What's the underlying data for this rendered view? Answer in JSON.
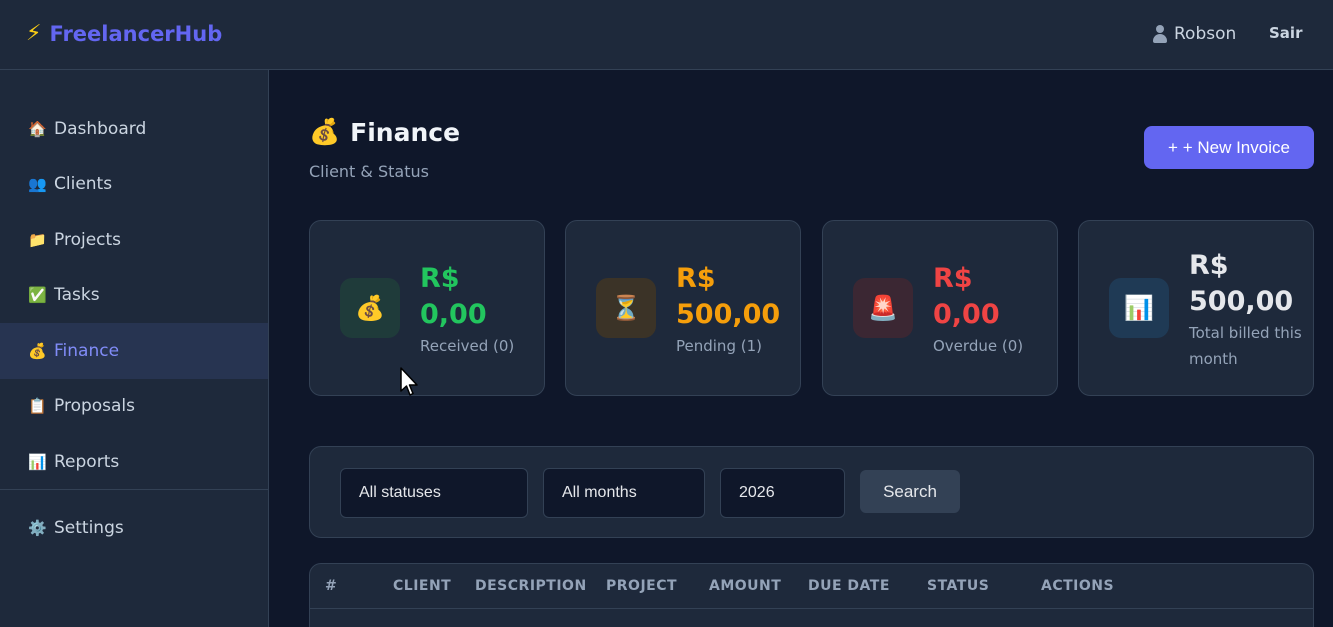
{
  "app": {
    "brand": "FreelancerHub",
    "brand_icon": "lightning-icon",
    "user_name": "Robson",
    "logout": "Sair"
  },
  "sidebar": {
    "items": [
      {
        "label": "Dashboard",
        "icon": "🏠",
        "active": false
      },
      {
        "label": "Clients",
        "icon": "👥",
        "active": false
      },
      {
        "label": "Projects",
        "icon": "📁",
        "active": false
      },
      {
        "label": "Tasks",
        "icon": "✅",
        "active": false
      },
      {
        "label": "Finance",
        "icon": "💰",
        "active": true
      },
      {
        "label": "Proposals",
        "icon": "📋",
        "active": false
      },
      {
        "label": "Reports",
        "icon": "📊",
        "active": false
      },
      {
        "label": "Settings",
        "icon": "⚙️",
        "active": false
      }
    ]
  },
  "page": {
    "icon": "💰",
    "title": "Finance",
    "subtitle": "Client & Status",
    "new_button": "+ + New Invoice"
  },
  "cards": [
    {
      "icon": "💰",
      "currency": "R$",
      "value": "0,00",
      "label": "Received (0)",
      "color": "#22c55e",
      "icon_bg": "#1f3b3a"
    },
    {
      "icon": "⏳",
      "currency": "R$",
      "value": "500,00",
      "label": "Pending (1)",
      "color": "#f59e0b",
      "icon_bg": "#3b3327"
    },
    {
      "icon": "🚨",
      "currency": "R$",
      "value": "0,00",
      "label": "Overdue (0)",
      "color": "#ef4444",
      "icon_bg": "#3b2733"
    },
    {
      "icon": "📊",
      "currency": "R$",
      "value": "500,00",
      "label": "Total billed this month",
      "color": "#e5e7eb",
      "icon_bg": "#1f3a55"
    }
  ],
  "filters": {
    "status": "All statuses",
    "month": "All months",
    "year": "2026",
    "search_button": "Search"
  },
  "table": {
    "headers": [
      "#",
      "CLIENT",
      "DESCRIPTION",
      "PROJECT",
      "AMOUNT",
      "DUE DATE",
      "STATUS",
      "ACTIONS"
    ]
  }
}
